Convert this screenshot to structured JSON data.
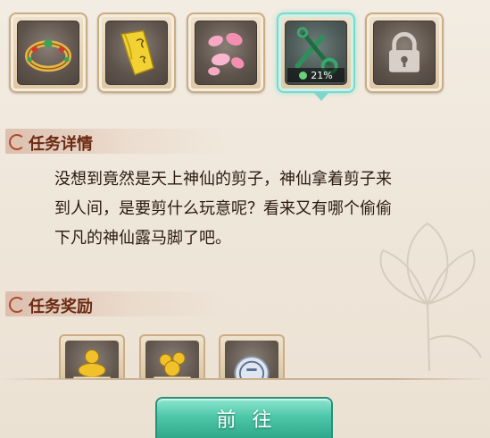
{
  "items": [
    {
      "name": "ring-icon",
      "selected": false,
      "locked": false
    },
    {
      "name": "scroll-icon",
      "selected": false,
      "locked": false
    },
    {
      "name": "petals-icon",
      "selected": false,
      "locked": false
    },
    {
      "name": "scissors-icon",
      "selected": true,
      "locked": false,
      "progress": "21%"
    },
    {
      "name": "lock-icon",
      "selected": false,
      "locked": true
    }
  ],
  "task_details": {
    "title": "任务详情",
    "line1": "没想到竟然是天上神仙的剪子，神仙拿着剪子来",
    "line2": "到人间，是要剪什么玩意呢？看来又有哪个偷偷",
    "line3": "下凡的神仙露马脚了吧。"
  },
  "task_rewards": {
    "title": "任务奖励",
    "items": [
      {
        "icon": "gold-ingot-exp-icon"
      },
      {
        "icon": "gold-coins-exp-icon"
      },
      {
        "icon": "silver-coin-icon"
      }
    ]
  },
  "go_button": "前往",
  "colors": {
    "accent": "#4fc7a9",
    "section_title": "#6b2a12"
  }
}
